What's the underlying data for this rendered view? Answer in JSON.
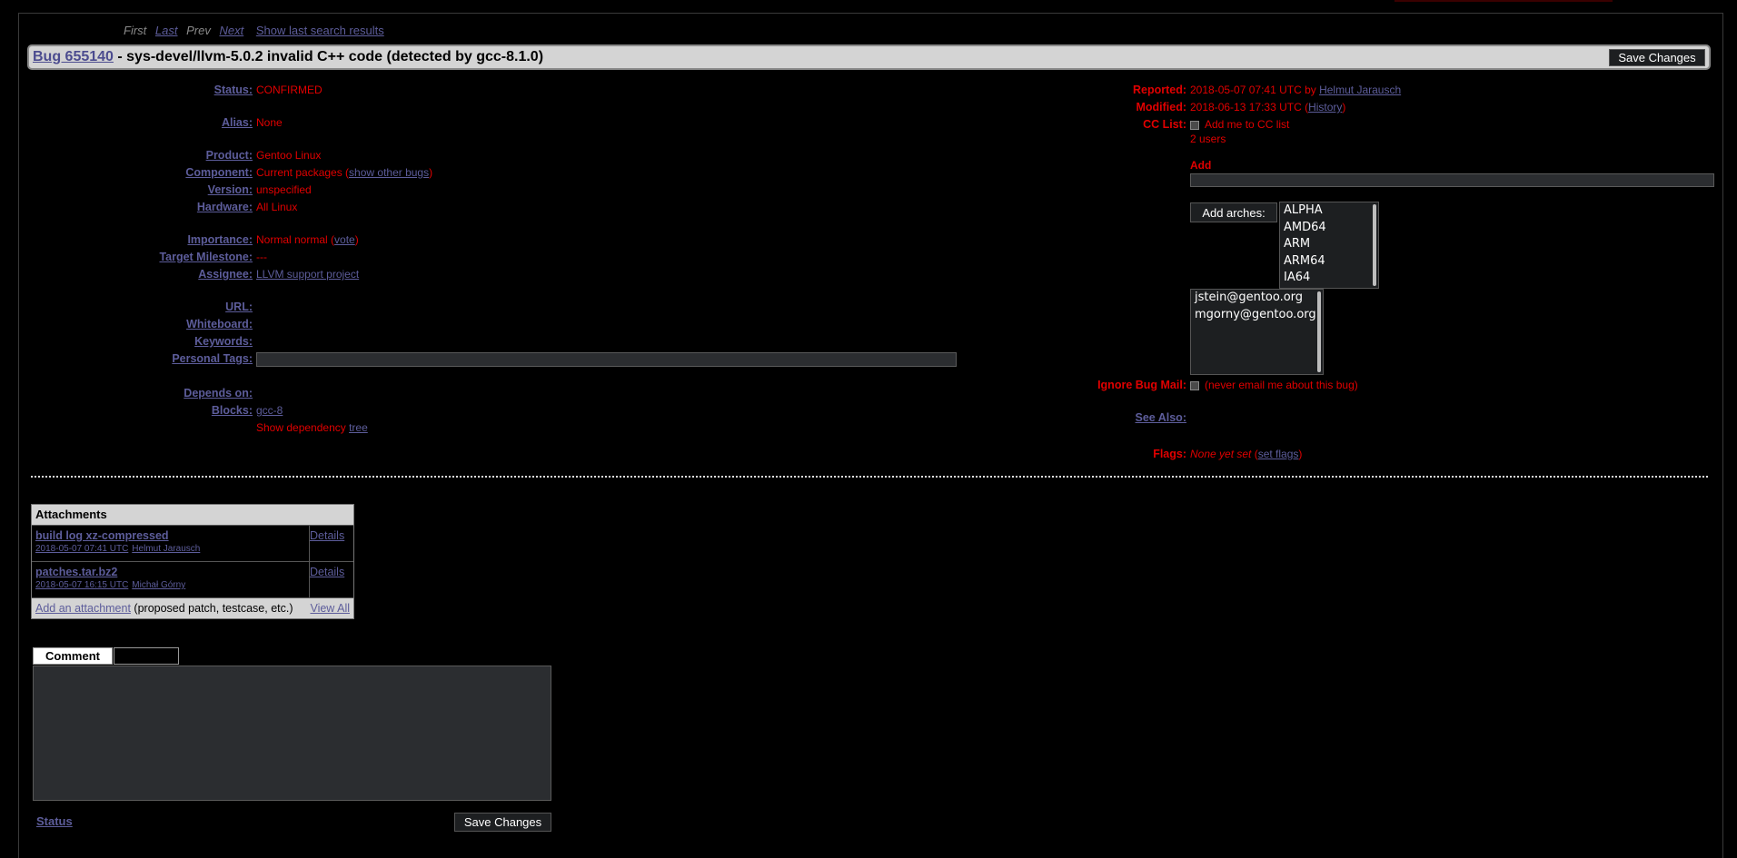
{
  "nav": {
    "first": "First",
    "last": "Last",
    "prev": "Prev",
    "next": "Next",
    "show_last": "Show last search results"
  },
  "bug": {
    "link": "Bug 655140",
    "title": " - sys-devel/llvm-5.0.2 invalid C++ code (detected by gcc-8.1.0)",
    "save_label": "Save Changes"
  },
  "left_fields": {
    "status": {
      "label": "Status:",
      "value": "CONFIRMED"
    },
    "alias": {
      "label": "Alias:",
      "value": "None"
    },
    "product": {
      "label": "Product:",
      "value": "Gentoo Linux"
    },
    "component": {
      "label": "Component:",
      "value": "Current packages (",
      "link": "show other bugs",
      "after": ")"
    },
    "version": {
      "label": "Version:",
      "value": "unspecified"
    },
    "hardware": {
      "label": "Hardware:",
      "value": "All Linux"
    },
    "importance": {
      "label": "Importance:",
      "value": "Normal normal (",
      "link": "vote",
      "after": ")"
    },
    "milestone": {
      "label": "Target Milestone:",
      "value": "---"
    },
    "assignee": {
      "label": "Assignee:",
      "link": "LLVM support project"
    },
    "url": {
      "label": "URL:"
    },
    "whiteboard": {
      "label": "Whiteboard:"
    },
    "keywords": {
      "label": "Keywords:"
    },
    "personal_tags": {
      "label": "Personal Tags:"
    },
    "depends_on": {
      "label": "Depends on:"
    },
    "blocks": {
      "label": "Blocks:",
      "link": "gcc-8"
    },
    "dep_tree": {
      "text": "Show dependency ",
      "link": "tree"
    }
  },
  "right_fields": {
    "reported": {
      "label": "Reported:",
      "value": "2018-05-07 07:41 UTC by ",
      "link": "Helmut Jarausch"
    },
    "modified": {
      "label": "Modified:",
      "value": "2018-06-13 17:33 UTC (",
      "link": "History",
      "after": ")"
    },
    "cc_list": {
      "label": "CC List:",
      "checkbox": "Add me to CC list",
      "users": "2 users"
    },
    "add_label": "Add",
    "add_arches_label": "Add arches:",
    "arches": [
      "ALPHA",
      "AMD64",
      "ARM",
      "ARM64",
      "IA64"
    ],
    "cc_emails": [
      "jstein@gentoo.org",
      "mgorny@gentoo.org"
    ],
    "ignore": {
      "label": "Ignore Bug Mail:",
      "text": "(never email me about this bug)"
    },
    "see_also": {
      "label": "See Also:"
    },
    "flags": {
      "label": "Flags:",
      "value": "None yet set",
      "pre": " (",
      "link": "set flags",
      "after": ")"
    }
  },
  "attachments": {
    "title": "Attachments",
    "items": [
      {
        "name": "build log xz-compressed",
        "date": "2018-05-07 07:41 UTC",
        "author": "Helmut Jarausch",
        "details": "Details"
      },
      {
        "name": "patches.tar.bz2",
        "date": "2018-05-07 16:15 UTC",
        "author": "Michał Górny",
        "details": "Details"
      }
    ],
    "add_link": "Add an attachment",
    "add_note": " (proposed patch, testcase, etc.)",
    "view_all": "View All"
  },
  "comment": {
    "tab_label": "Comment",
    "status_link": "Status",
    "save_label": "Save Changes"
  }
}
